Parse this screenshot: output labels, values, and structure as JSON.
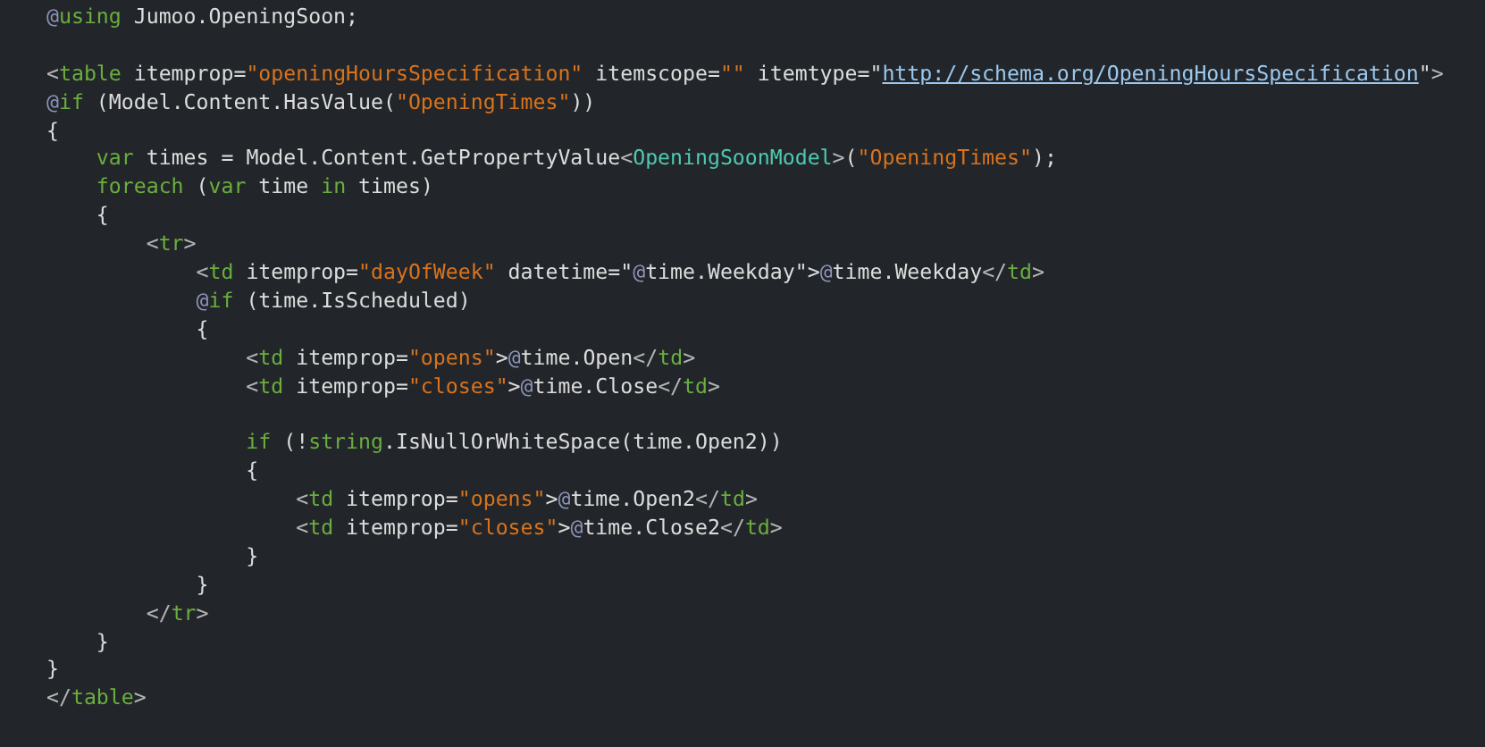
{
  "editor": {
    "lines": [
      {
        "kind": "code",
        "tokens": [
          {
            "text": "@",
            "kind": "razor"
          },
          {
            "text": "using",
            "kind": "keyword"
          },
          {
            "text": " Jumoo.OpeningSoon;",
            "kind": "plain"
          }
        ]
      },
      {
        "kind": "blank"
      },
      {
        "kind": "code",
        "tokens": [
          {
            "text": "<",
            "kind": "punct"
          },
          {
            "text": "table",
            "kind": "tag"
          },
          {
            "text": " itemprop=",
            "kind": "plain"
          },
          {
            "text": "\"openingHoursSpecification\"",
            "kind": "string"
          },
          {
            "text": " itemscope=",
            "kind": "plain"
          },
          {
            "text": "\"\"",
            "kind": "string"
          },
          {
            "text": " itemtype=\"",
            "kind": "plain"
          },
          {
            "text": "http://schema.org/OpeningHoursSpecification",
            "kind": "link"
          },
          {
            "text": "\"",
            "kind": "plain"
          },
          {
            "text": ">",
            "kind": "punct"
          }
        ]
      },
      {
        "kind": "code",
        "tokens": [
          {
            "text": "@",
            "kind": "razor"
          },
          {
            "text": "if",
            "kind": "keyword"
          },
          {
            "text": " (Model.Content.HasValue(",
            "kind": "plain"
          },
          {
            "text": "\"OpeningTimes\"",
            "kind": "string"
          },
          {
            "text": "))",
            "kind": "plain"
          }
        ]
      },
      {
        "kind": "code",
        "tokens": [
          {
            "text": "{",
            "kind": "plain"
          }
        ]
      },
      {
        "kind": "code",
        "tokens": [
          {
            "text": "    var",
            "kind": "keyword"
          },
          {
            "text": " times = Model.Content.GetPropertyValue",
            "kind": "plain"
          },
          {
            "text": "<",
            "kind": "punct"
          },
          {
            "text": "OpeningSoonModel",
            "kind": "type"
          },
          {
            "text": ">",
            "kind": "punct"
          },
          {
            "text": "(",
            "kind": "plain"
          },
          {
            "text": "\"OpeningTimes\"",
            "kind": "string"
          },
          {
            "text": ");",
            "kind": "plain"
          }
        ]
      },
      {
        "kind": "code",
        "tokens": [
          {
            "text": "    foreach",
            "kind": "keyword"
          },
          {
            "text": " (",
            "kind": "plain"
          },
          {
            "text": "var",
            "kind": "keyword"
          },
          {
            "text": " time ",
            "kind": "plain"
          },
          {
            "text": "in",
            "kind": "keyword"
          },
          {
            "text": " times)",
            "kind": "plain"
          }
        ]
      },
      {
        "kind": "code",
        "tokens": [
          {
            "text": "    {",
            "kind": "plain"
          }
        ]
      },
      {
        "kind": "code",
        "tokens": [
          {
            "text": "        <",
            "kind": "punct"
          },
          {
            "text": "tr",
            "kind": "tag"
          },
          {
            "text": ">",
            "kind": "punct"
          }
        ]
      },
      {
        "kind": "code",
        "tokens": [
          {
            "text": "            <",
            "kind": "punct"
          },
          {
            "text": "td",
            "kind": "tag"
          },
          {
            "text": " itemprop=",
            "kind": "plain"
          },
          {
            "text": "\"dayOfWeek\"",
            "kind": "string"
          },
          {
            "text": " datetime=\"",
            "kind": "plain"
          },
          {
            "text": "@",
            "kind": "razor"
          },
          {
            "text": "time.Weekday\">",
            "kind": "plain"
          },
          {
            "text": "@",
            "kind": "razor"
          },
          {
            "text": "time.Weekday",
            "kind": "plain"
          },
          {
            "text": "</",
            "kind": "punct"
          },
          {
            "text": "td",
            "kind": "tag"
          },
          {
            "text": ">",
            "kind": "punct"
          }
        ]
      },
      {
        "kind": "code",
        "tokens": [
          {
            "text": "            @",
            "kind": "razor"
          },
          {
            "text": "if",
            "kind": "keyword"
          },
          {
            "text": " (time.IsScheduled)",
            "kind": "plain"
          }
        ]
      },
      {
        "kind": "code",
        "tokens": [
          {
            "text": "            {",
            "kind": "plain"
          }
        ]
      },
      {
        "kind": "code",
        "tokens": [
          {
            "text": "                <",
            "kind": "punct"
          },
          {
            "text": "td",
            "kind": "tag"
          },
          {
            "text": " itemprop=",
            "kind": "plain"
          },
          {
            "text": "\"opens\"",
            "kind": "string"
          },
          {
            "text": ">",
            "kind": "plain"
          },
          {
            "text": "@",
            "kind": "razor"
          },
          {
            "text": "time.Open",
            "kind": "plain"
          },
          {
            "text": "</",
            "kind": "punct"
          },
          {
            "text": "td",
            "kind": "tag"
          },
          {
            "text": ">",
            "kind": "punct"
          }
        ]
      },
      {
        "kind": "code",
        "tokens": [
          {
            "text": "                <",
            "kind": "punct"
          },
          {
            "text": "td",
            "kind": "tag"
          },
          {
            "text": " itemprop=",
            "kind": "plain"
          },
          {
            "text": "\"closes\"",
            "kind": "string"
          },
          {
            "text": ">",
            "kind": "plain"
          },
          {
            "text": "@",
            "kind": "razor"
          },
          {
            "text": "time.Close",
            "kind": "plain"
          },
          {
            "text": "</",
            "kind": "punct"
          },
          {
            "text": "td",
            "kind": "tag"
          },
          {
            "text": ">",
            "kind": "punct"
          }
        ]
      },
      {
        "kind": "blank"
      },
      {
        "kind": "code",
        "tokens": [
          {
            "text": "                if",
            "kind": "keyword"
          },
          {
            "text": " (!",
            "kind": "plain"
          },
          {
            "text": "string",
            "kind": "keyword"
          },
          {
            "text": ".IsNullOrWhiteSpace(time.Open2))",
            "kind": "plain"
          }
        ]
      },
      {
        "kind": "code",
        "tokens": [
          {
            "text": "                {",
            "kind": "plain"
          }
        ]
      },
      {
        "kind": "code",
        "tokens": [
          {
            "text": "                    <",
            "kind": "punct"
          },
          {
            "text": "td",
            "kind": "tag"
          },
          {
            "text": " itemprop=",
            "kind": "plain"
          },
          {
            "text": "\"opens\"",
            "kind": "string"
          },
          {
            "text": ">",
            "kind": "plain"
          },
          {
            "text": "@",
            "kind": "razor"
          },
          {
            "text": "time.Open2",
            "kind": "plain"
          },
          {
            "text": "</",
            "kind": "punct"
          },
          {
            "text": "td",
            "kind": "tag"
          },
          {
            "text": ">",
            "kind": "punct"
          }
        ]
      },
      {
        "kind": "code",
        "tokens": [
          {
            "text": "                    <",
            "kind": "punct"
          },
          {
            "text": "td",
            "kind": "tag"
          },
          {
            "text": " itemprop=",
            "kind": "plain"
          },
          {
            "text": "\"closes\"",
            "kind": "string"
          },
          {
            "text": ">",
            "kind": "plain"
          },
          {
            "text": "@",
            "kind": "razor"
          },
          {
            "text": "time.Close2",
            "kind": "plain"
          },
          {
            "text": "</",
            "kind": "punct"
          },
          {
            "text": "td",
            "kind": "tag"
          },
          {
            "text": ">",
            "kind": "punct"
          }
        ]
      },
      {
        "kind": "code",
        "tokens": [
          {
            "text": "                }",
            "kind": "plain"
          }
        ]
      },
      {
        "kind": "code",
        "tokens": [
          {
            "text": "            }",
            "kind": "plain"
          }
        ]
      },
      {
        "kind": "code",
        "tokens": [
          {
            "text": "        </",
            "kind": "punct"
          },
          {
            "text": "tr",
            "kind": "tag"
          },
          {
            "text": ">",
            "kind": "punct"
          }
        ]
      },
      {
        "kind": "code",
        "tokens": [
          {
            "text": "    }",
            "kind": "plain"
          }
        ]
      },
      {
        "kind": "code",
        "tokens": [
          {
            "text": "}",
            "kind": "plain"
          }
        ]
      },
      {
        "kind": "code",
        "tokens": [
          {
            "text": "</",
            "kind": "punct"
          },
          {
            "text": "table",
            "kind": "tag"
          },
          {
            "text": ">",
            "kind": "punct"
          }
        ]
      }
    ]
  }
}
